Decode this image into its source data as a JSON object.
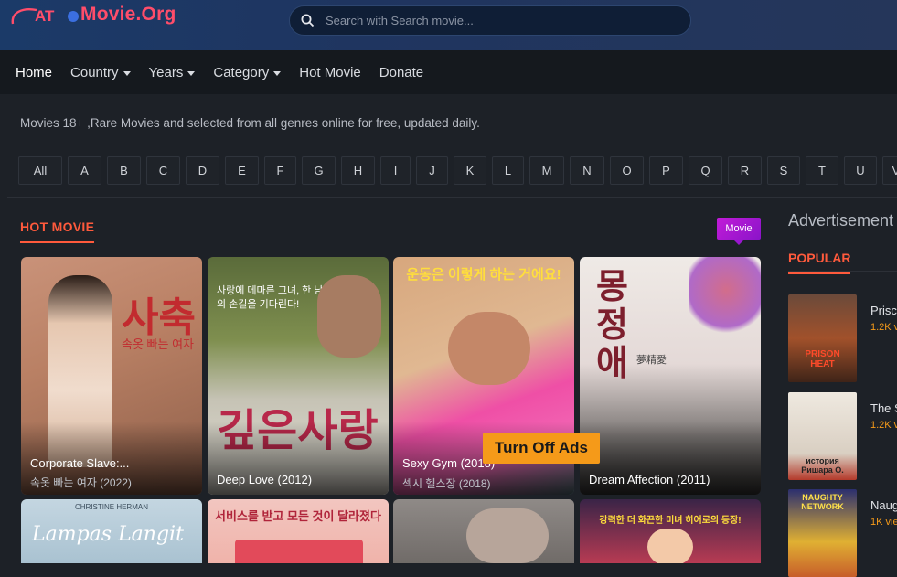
{
  "site": {
    "logo_mark": "AT",
    "logo_text": "Movie.Org"
  },
  "search": {
    "placeholder": "Search with Search movie..."
  },
  "nav": [
    {
      "label": "Home",
      "dropdown": false
    },
    {
      "label": "Country",
      "dropdown": true
    },
    {
      "label": "Years",
      "dropdown": true
    },
    {
      "label": "Category",
      "dropdown": true
    },
    {
      "label": "Hot Movie",
      "dropdown": false
    },
    {
      "label": "Donate",
      "dropdown": false
    }
  ],
  "tagline": "Movies 18+ ,Rare Movies and selected from all genres online for free, updated daily.",
  "alphabet": [
    "All",
    "A",
    "B",
    "C",
    "D",
    "E",
    "F",
    "G",
    "H",
    "I",
    "J",
    "K",
    "L",
    "M",
    "N",
    "O",
    "P",
    "Q",
    "R",
    "S",
    "T",
    "U",
    "V"
  ],
  "hot": {
    "title": "HOT MOVIE",
    "badge": "Movie"
  },
  "movies": [
    {
      "title": "Corporate Slave:...",
      "subtitle": "속옷 빠는 여자 (2022)",
      "poster_text": "사축",
      "poster_sub": "속옷 빠는 여자"
    },
    {
      "title": "Deep Love (2012)",
      "subtitle": "",
      "poster_text": "깊은사랑",
      "poster_sub": "사랑에 메마른 그녀, 한 남자의 손길을 기다린다!"
    },
    {
      "title": "Sexy Gym (2018)",
      "subtitle": "섹시 헬스장 (2018)",
      "poster_text": "운동은 이렇게 하는 거에요!",
      "poster_sub": ""
    },
    {
      "title": "Dream Affection (2011)",
      "subtitle": "",
      "poster_text": "몽정애",
      "poster_sub": "夢精愛"
    }
  ],
  "row2": [
    {
      "poster_text": "Lampas Langit",
      "poster_sub": "CHRISTINE HERMAN"
    },
    {
      "poster_text": "서비스를 받고 모든 것이 달라졌다",
      "poster_sub": ""
    },
    {
      "poster_text": "",
      "poster_sub": ""
    },
    {
      "poster_text": "강력한 더 화끈한 미녀 히어로의 등장!",
      "poster_sub": ""
    }
  ],
  "ads_button": "Turn Off Ads",
  "sidebar": {
    "advert": "Advertisement",
    "popular_title": "POPULAR",
    "items": [
      {
        "name": "Prisc",
        "views": "1.2K v",
        "poster_text": "PRISON HEAT"
      },
      {
        "name": "The S",
        "views": "1.2K v",
        "poster_text": "история Ришара О."
      },
      {
        "name": "Naug",
        "views": "1K vie",
        "poster_text": "NAUGHTY NETWORK"
      }
    ]
  },
  "colors": {
    "accent": "#ff5a3c",
    "badge": "#c21bd8",
    "ads": "#f59a19",
    "logo": "#ff4d6a"
  }
}
